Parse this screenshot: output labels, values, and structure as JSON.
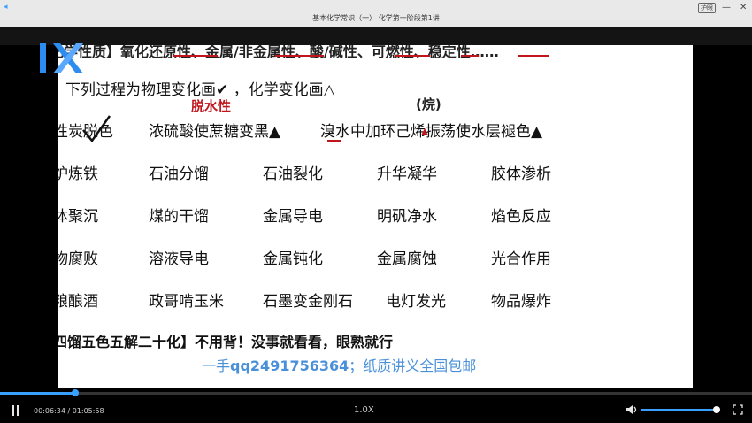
{
  "window": {
    "title": "基本化学常识（一） 化学第一阶段第1讲",
    "badge": "护眼",
    "minimize": "—",
    "close": "✕"
  },
  "slide": {
    "instruction": "下列过程为物理变化画✔ ，化学变化画△",
    "rows": [
      [
        "性炭脱色",
        "浓硫酸使蔗糖变黑▲",
        "溴水中加环己烯振荡使水层褪色▲"
      ],
      [
        "炉炼铁",
        "石油分馏",
        "石油裂化",
        "升华凝华",
        "胶体渗析"
      ],
      [
        "体聚沉",
        "煤的干馏",
        "金属导电",
        "明矾净水",
        "焰色反应"
      ],
      [
        "物腐败",
        "溶液导电",
        "金属钝化",
        "金属腐蚀",
        "光合作用"
      ],
      [
        "粮酿酒",
        "政哥啃玉米",
        "石墨变金刚石",
        "电灯发光",
        "物品爆炸"
      ]
    ],
    "handnotes": {
      "dehydration": "脱水性",
      "alkene": "(烷)"
    },
    "bottom_note": "四馏五色五解二十化】不用背！没事就看看，眼熟就行",
    "watermark_prefix": "一手",
    "watermark_qq": "qq2491756364",
    "watermark_suffix": "；纸质讲义全国包邮",
    "top_partial": "化学性质】氧化还原性、金属/非金属性、酸/碱性、可燃性、稳定性……"
  },
  "player": {
    "play_state": "paused",
    "current_time": "00:06:34",
    "total_time": "01:05:58",
    "time_sep": " / ",
    "speed": "1.0X",
    "progress_fraction": 0.1,
    "volume_fraction": 1.0,
    "accent_color": "#3aa0ff"
  }
}
